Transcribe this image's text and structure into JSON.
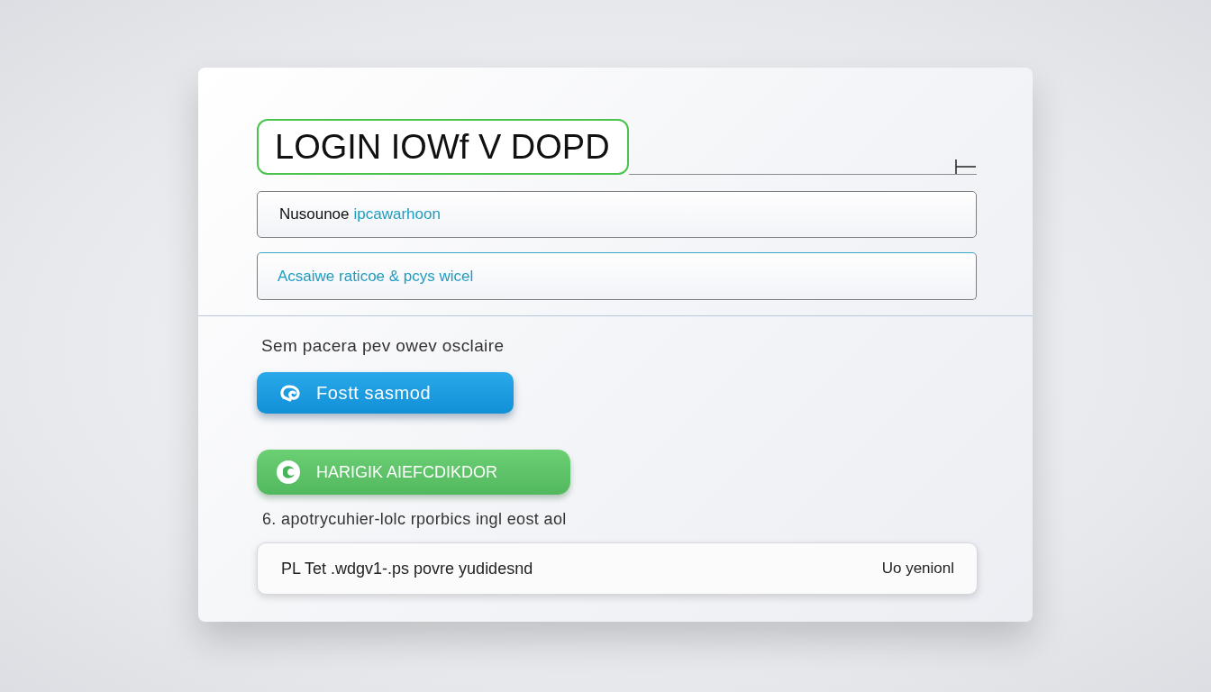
{
  "title": {
    "text": "LOGIN IOWf V DOPD"
  },
  "fields": [
    {
      "focused": false,
      "parts": [
        {
          "text": "Nusounoe",
          "accent": false
        },
        {
          "text": "ipcawarhoon",
          "accent": true
        }
      ]
    },
    {
      "focused": true,
      "parts": [
        {
          "text": "Acsaiwe raticoe & pcys wicel",
          "accent": true
        }
      ]
    }
  ],
  "note": "Sem pacera pev owev osclaire",
  "buttons": [
    {
      "kind": "primary",
      "label": "Fostt sasmod"
    },
    {
      "kind": "success",
      "label": "HARIGIK AIEFCDIKDOR"
    }
  ],
  "caption": "6. apotrycuhier-lolc rporbics ingl eost aol",
  "footer": {
    "text": "PL Tet .wdgv1-.ps povre yudidesnd",
    "link": "Uo yenionl"
  }
}
